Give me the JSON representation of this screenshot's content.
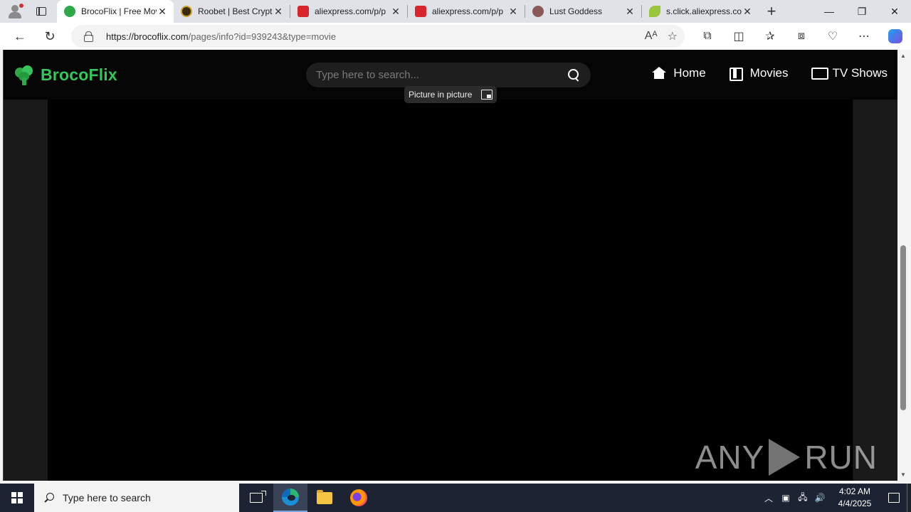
{
  "browser": {
    "tabs": [
      {
        "title": "BrocoFlix | Free Movies",
        "active": true,
        "favicon": "broccoli-icon",
        "color": "#2fa84a"
      },
      {
        "title": "Roobet | Best Crypto",
        "active": false,
        "favicon": "roobet-icon",
        "color": "#3b2a10"
      },
      {
        "title": "aliexpress.com/p/p",
        "active": false,
        "favicon": "aliexpress-icon",
        "color": "#d9262c"
      },
      {
        "title": "aliexpress.com/p/p",
        "active": false,
        "favicon": "aliexpress-icon",
        "color": "#d9262c"
      },
      {
        "title": "Lust Goddess",
        "active": false,
        "favicon": "lust-goddess-icon",
        "color": "#8a5a5a"
      },
      {
        "title": "s.click.aliexpress.co",
        "active": false,
        "favicon": "leaf-icon",
        "color": "#9bc53d"
      }
    ],
    "url_host": "https://brocoflix.com",
    "url_path": "/pages/info?id=939243&type=movie"
  },
  "site": {
    "logo_text": "BrocoFlix",
    "search_placeholder": "Type here to search...",
    "nav": {
      "home": "Home",
      "movies": "Movies",
      "tv_shows": "TV Shows"
    },
    "pip_tooltip": "Picture in picture",
    "accent": "#34c759"
  },
  "watermark": {
    "left": "ANY",
    "right": "RUN"
  },
  "taskbar": {
    "search_placeholder": "Type here to search",
    "time": "4:02 AM",
    "date": "4/4/2025"
  }
}
